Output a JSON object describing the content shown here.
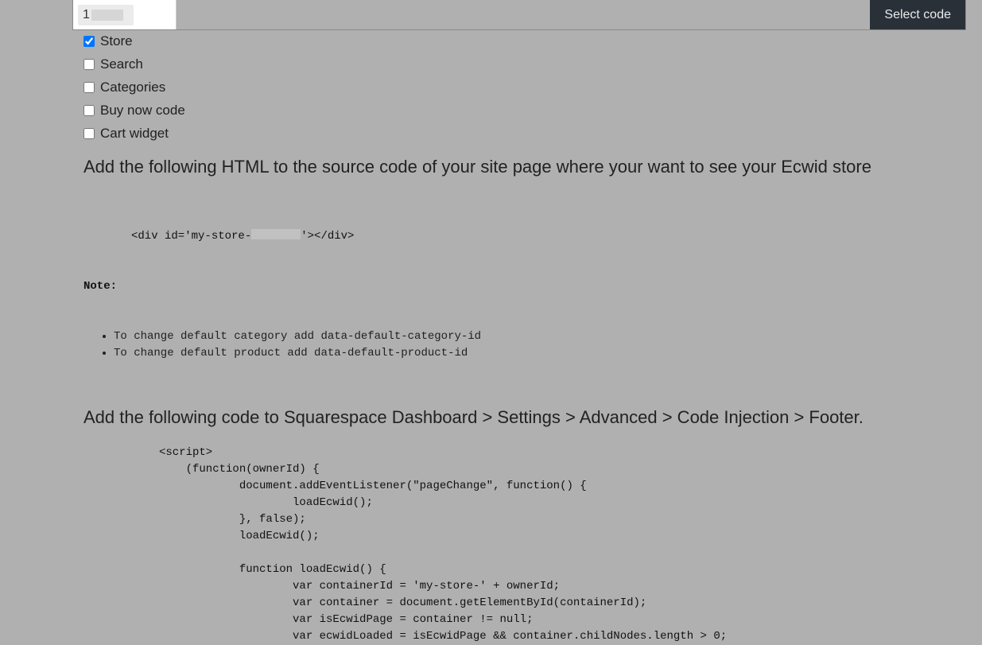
{
  "topBar": {
    "inputPrefix": "1",
    "selectCodeLabel": "Select code"
  },
  "checkboxes": [
    {
      "label": "Store",
      "checked": true
    },
    {
      "label": "Search",
      "checked": false
    },
    {
      "label": "Categories",
      "checked": false
    },
    {
      "label": "Buy now code",
      "checked": false
    },
    {
      "label": "Cart widget",
      "checked": false
    }
  ],
  "heading1": "Add the following HTML to the source code of your site page where your want to see your Ecwid store",
  "htmlSnippet": {
    "divOpen": "<div id='my-store-",
    "divClose": "'></div>",
    "noteLabel": "Note:",
    "bullets": [
      "To change default category add data-default-category-id",
      "To change default product add data-default-product-id"
    ]
  },
  "heading2": "Add the following code to Squarespace Dashboard > Settings > Advanced > Code Injection > Footer.",
  "scriptCode": "<script>\n    (function(ownerId) {\n            document.addEventListener(\"pageChange\", function() {\n                    loadEcwid();\n            }, false);\n            loadEcwid();\n\n            function loadEcwid() {\n                    var containerId = 'my-store-' + ownerId;\n                    var container = document.getElementById(containerId);\n                    var isEcwidPage = container != null;\n                    var ecwidLoaded = isEcwidPage && container.childNodes.length > 0;"
}
